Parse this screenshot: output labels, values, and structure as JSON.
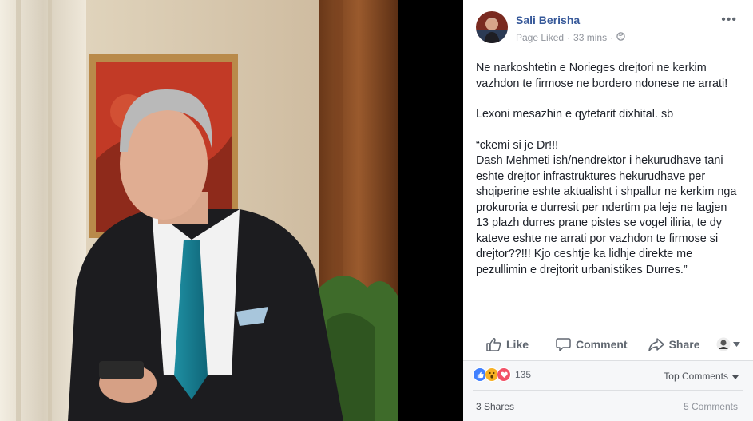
{
  "post": {
    "author": "Sali Berisha",
    "status": "Page Liked",
    "separator": "·",
    "time": "33 mins",
    "separator2": "·",
    "more_icon": "more-icon",
    "paragraphs": [
      "Ne narkoshtetin e Norieges drejtori ne kerkim vazhdon te firmose ne bordero ndonese ne arrati!",
      "Lexoni mesazhin e qytetarit dixhital. sb",
      "“ckemi si je Dr!!!\nDash Mehmeti ish/nendrektor i hekurudhave tani eshte drejtor infrastruktures hekurudhave per shqiperine eshte aktualisht i shpallur ne kerkim nga prokuroria e durresit per ndertim pa leje ne lagjen 13 plazh durres prane pistes se vogel iliria, te dy kateve eshte ne arrati por vazhdon te firmose si drejtor??!!! Kjo ceshtje ka lidhje direkte me pezullimin e drejtorit urbanistikes Durres.”"
    ]
  },
  "actions": {
    "like": "Like",
    "comment": "Comment",
    "share": "Share"
  },
  "stats": {
    "reaction_count": "135",
    "top_comments": "Top Comments",
    "shares": "3 Shares",
    "comments": "5 Comments"
  },
  "colors": {
    "link_blue": "#365899",
    "like_blue": "#4080ff",
    "wow_yellow": "#f7b125",
    "love_red": "#f25268"
  }
}
